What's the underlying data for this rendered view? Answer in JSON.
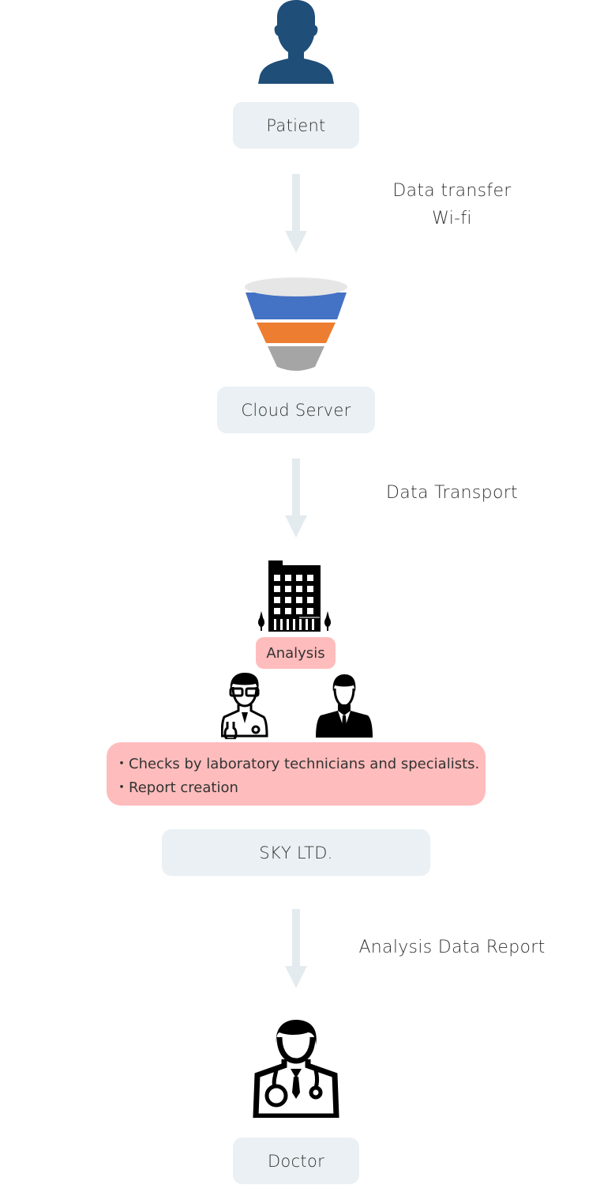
{
  "nodes": {
    "patient": {
      "label": "Patient",
      "icon": "person-icon"
    },
    "cloud_server": {
      "label": "Cloud Server",
      "icon": "funnel-icon"
    },
    "analysis": {
      "label": "Analysis",
      "icon": "building-icon"
    },
    "sky": {
      "label": "SKY LTD."
    },
    "doctor": {
      "label": "Doctor",
      "icon": "doctor-icon"
    }
  },
  "edges": [
    {
      "from": "patient",
      "to": "cloud_server",
      "lines": [
        "Data transfer",
        "Wi-fi"
      ]
    },
    {
      "from": "cloud_server",
      "to": "sky",
      "lines": [
        "Data Transport"
      ]
    },
    {
      "from": "sky",
      "to": "doctor",
      "lines": [
        "Analysis Data Report"
      ]
    }
  ],
  "analysis_details": {
    "bullets": [
      "・Checks by laboratory technicians and specialists.",
      "・Report creation"
    ]
  },
  "colors": {
    "label_bg": "#eaf0f3",
    "highlight_bg": "#ffbcbc",
    "arrow": "#e3ebef",
    "patient_icon": "#1f4e79",
    "funnel_top": "#e6e6e6",
    "funnel_blue": "#4472c4",
    "funnel_orange": "#ed7d31",
    "funnel_gray": "#a5a5a5"
  }
}
